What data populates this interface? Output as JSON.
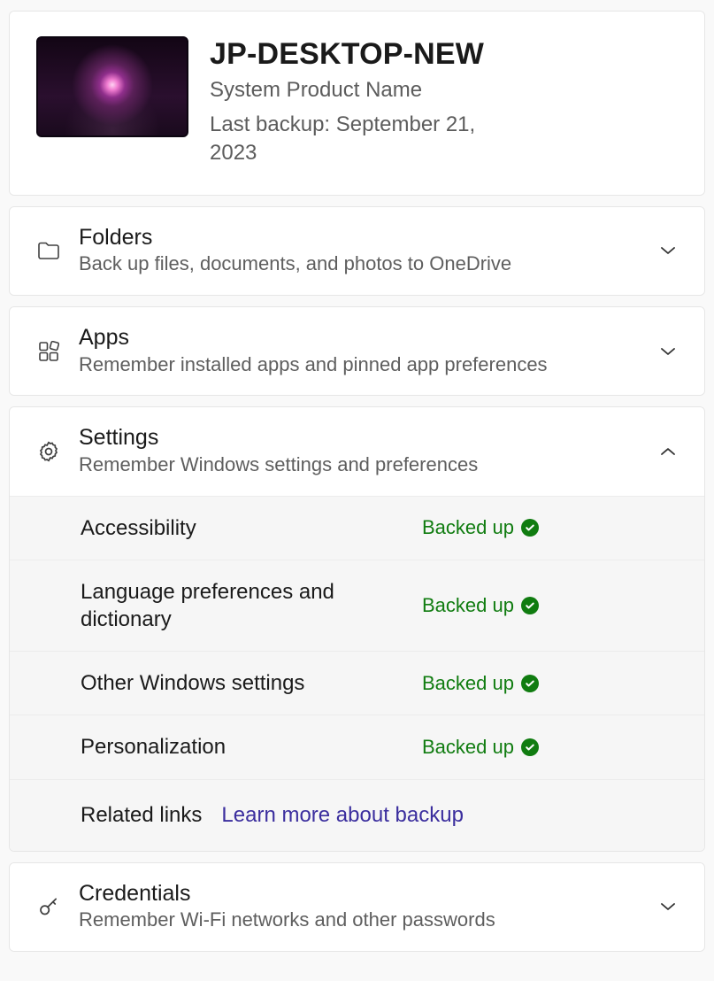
{
  "device": {
    "name": "JP-DESKTOP-NEW",
    "product": "System Product Name",
    "last_backup": "Last backup: September 21, 2023"
  },
  "sections": {
    "folders": {
      "title": "Folders",
      "desc": "Back up files, documents, and photos to OneDrive",
      "expanded": false
    },
    "apps": {
      "title": "Apps",
      "desc": "Remember installed apps and pinned app preferences",
      "expanded": false
    },
    "settings": {
      "title": "Settings",
      "desc": "Remember Windows settings and preferences",
      "expanded": true,
      "items": [
        {
          "label": "Accessibility",
          "status": "Backed up"
        },
        {
          "label": "Language preferences and dictionary",
          "status": "Backed up"
        },
        {
          "label": "Other Windows settings",
          "status": "Backed up"
        },
        {
          "label": "Personalization",
          "status": "Backed up"
        }
      ],
      "related_label": "Related links",
      "related_link": "Learn more about backup"
    },
    "credentials": {
      "title": "Credentials",
      "desc": "Remember Wi-Fi networks and other passwords",
      "expanded": false
    }
  },
  "colors": {
    "status_green": "#107C10",
    "link_purple": "#3b2e9e"
  }
}
